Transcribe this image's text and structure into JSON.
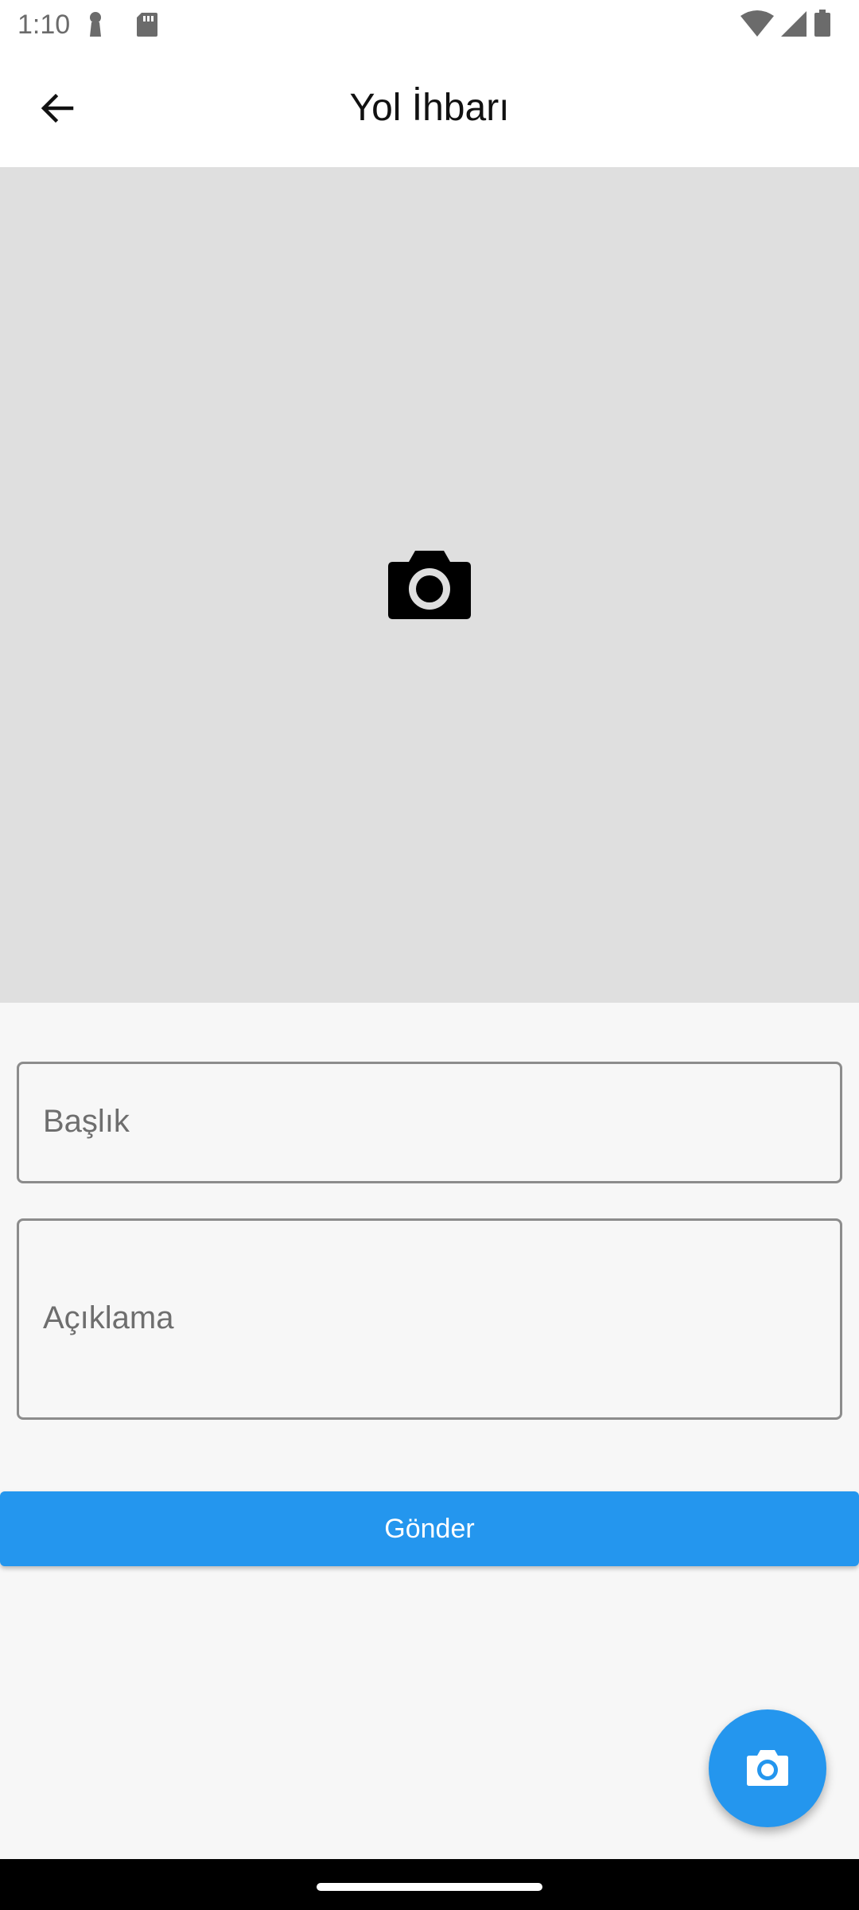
{
  "status_bar": {
    "time": "1:10",
    "left_icons": [
      "keyhole-icon",
      "sd-card-icon"
    ],
    "right_icons": [
      "wifi-icon",
      "cell-signal-icon",
      "battery-icon"
    ]
  },
  "app_bar": {
    "back_icon": "arrow-back-icon",
    "title": "Yol İhbarı"
  },
  "photo_area": {
    "icon": "camera-icon",
    "background_color": "#dfdfdf"
  },
  "form": {
    "title_placeholder": "Başlık",
    "description_placeholder": "Açıklama",
    "submit_label": "Gönder"
  },
  "fab": {
    "icon": "camera-icon"
  },
  "colors": {
    "accent": "#2496ee",
    "surface": "#f7f7f7",
    "appbar": "#ffffff"
  }
}
